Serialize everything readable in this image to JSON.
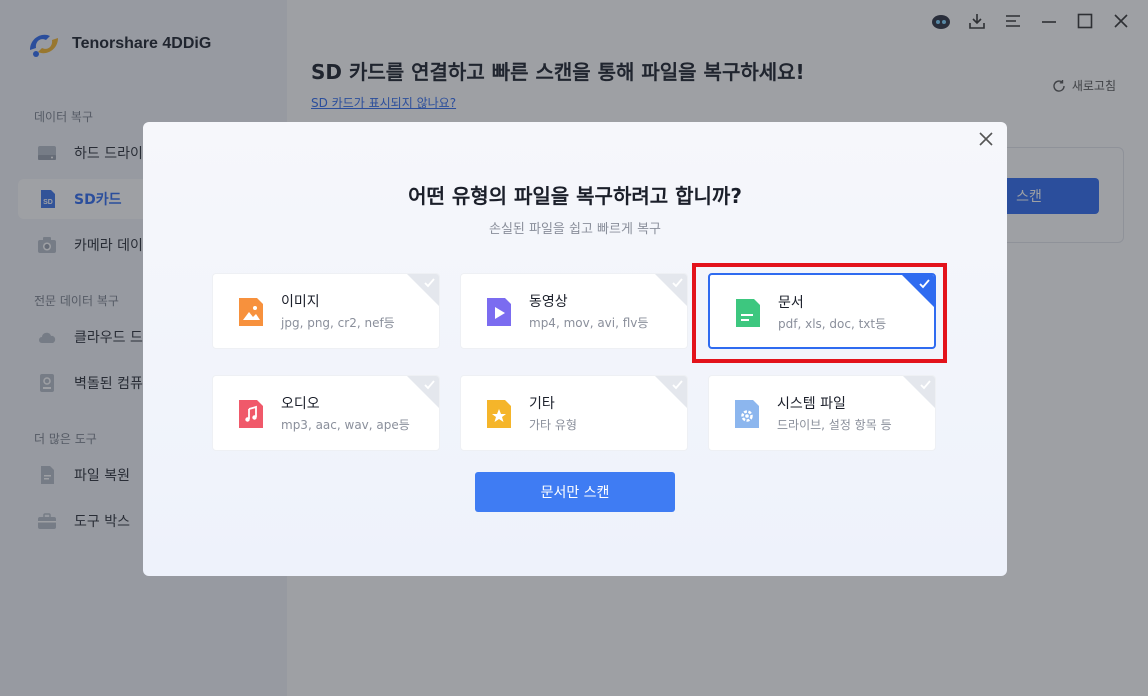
{
  "app": {
    "name": "Tenorshare 4DDiG"
  },
  "sidebar": {
    "sections": [
      {
        "title": "데이터 복구",
        "items": [
          {
            "label": "하드 드라이",
            "icon": "hard-drive-icon"
          },
          {
            "label": "SD카드",
            "icon": "sd-card-icon",
            "active": true
          },
          {
            "label": "카메라 데이",
            "icon": "camera-icon"
          }
        ]
      },
      {
        "title": "전문 데이터 복구",
        "items": [
          {
            "label": "클라우드 드",
            "icon": "cloud-icon"
          },
          {
            "label": "벽돌된 컴퓨",
            "icon": "bricked-pc-icon"
          }
        ]
      },
      {
        "title": "더 많은 도구",
        "items": [
          {
            "label": "파일 복원",
            "icon": "file-icon"
          },
          {
            "label": "도구 박스",
            "icon": "toolbox-icon"
          }
        ]
      }
    ]
  },
  "main": {
    "title": "SD 카드를 연결하고 빠른 스캔을 통해 파일을 복구하세요!",
    "help_link": "SD 카드가 표시되지 않나요?",
    "refresh_label": "새로고침",
    "scan_label": "스캔"
  },
  "modal": {
    "title": "어떤 유형의 파일을 복구하려고 합니까?",
    "subtitle": "손실된 파일을 쉽고 빠르게 복구",
    "types": [
      {
        "label": "이미지",
        "desc": "jpg, png, cr2, nef등",
        "icon": "image-icon",
        "color": "#f7913d"
      },
      {
        "label": "동영상",
        "desc": "mp4, mov, avi, flv등",
        "icon": "video-icon",
        "color": "#7b6cf0"
      },
      {
        "label": "문서",
        "desc": "pdf, xls, doc, txt등",
        "icon": "document-icon",
        "color": "#3dc77f",
        "selected": true
      },
      {
        "label": "오디오",
        "desc": "mp3, aac, wav, ape등",
        "icon": "audio-icon",
        "color": "#f0596a"
      },
      {
        "label": "기타",
        "desc": "가타 유형",
        "icon": "star-file-icon",
        "color": "#f5b52a"
      },
      {
        "label": "시스템 파일",
        "desc": "드라이브, 설정 항목 등",
        "icon": "system-file-icon",
        "color": "#8cb6ee"
      }
    ],
    "scan_button": "문서만 스캔"
  },
  "colors": {
    "accent": "#2f6bf0",
    "highlight": "#e3131b"
  }
}
